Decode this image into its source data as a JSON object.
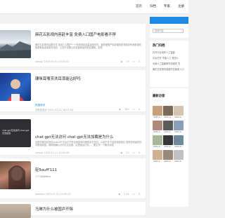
{
  "nav": {
    "items": [
      "首页",
      "归档",
      "专家",
      "注册"
    ]
  },
  "articles": [
    {
      "title": "麻花五影视内容赶丰富 免费入口国产电影看不停",
      "desc": "麻花五影视内容超丰富 免费入口国产一个电影和精选星桌相关内，被热爱国产精彩播放影视精彩有我看观影想观看星桌电影的电影，让您不仅随心欣赏最新最热电影播映，影视",
      "meta": "yangyi 2025-03-31 23:22:22",
      "stats": {
        "views": "19",
        "comments": "0"
      }
    },
    {
      "title": "珊咪耳嘴芳洗耳漆能沾好吗",
      "category": "热搜资讯",
      "meta": "沉默的漫步 2020-07-11 16:51:54",
      "stats": {
        "views": "384",
        "comments": "0"
      }
    },
    {
      "title": "chat gpt无法访问 chat gpt无法加载是为什么",
      "thumb_text": "chat gpt无法访问 chat gpt无法加载",
      "desc": "这是时候比较常见chatGPT平台打不开出现各种问题的多方情况，从用户多下载发现现场并 发现在网最终的中断常原因，那网络确认访问无法出现，后里面运行也。。要生作一个解决问题",
      "meta": "yangyi 2020-07-11 10:40:28",
      "stats": {
        "views": "23",
        "comments": "0"
      }
    },
    {
      "title": "轻5ouff'111",
      "desc": "777166666ne",
      "meta": "semenp 2025-07-31 10:00:52",
      "stats": {
        "views": "2.4k",
        "comments": "0"
      }
    },
    {
      "title": "马琳为什么被国乒开除"
    }
  ],
  "sidebar": {
    "search_placeholder": "搜索内容",
    "hot_title": "热门归档",
    "hot_items": [
      "抖开行业动作人工智能",
      "平台打开 不能人工 是怎么",
      "对我人工智能研究动相关 先",
      "麻花五影视内容超丰富免费入口"
    ],
    "visitors_title": "最新访客",
    "visitors": [
      {
        "date": "2025-0...",
        "color": "#c9a07a"
      },
      {
        "date": "2025-0...",
        "color": "#7a6a5a"
      },
      {
        "date": "2025-0...",
        "color": "#d8c2b0"
      },
      {
        "date": "2025-0...",
        "color": "#b08a7a"
      },
      {
        "date": "2025-0...",
        "color": "#5a5a5a"
      },
      {
        "date": "2025-0...",
        "color": "#8aa0b8"
      },
      {
        "date": "2025-0...",
        "color": "#a8b898"
      },
      {
        "date": "2025-0...",
        "color": "#383838"
      },
      {
        "date": "2025-0...",
        "color": "#6c8a9a"
      },
      {
        "date": "2025-0...",
        "color": "#d0b090"
      },
      {
        "date": "2025-0...",
        "color": "#9a8a7a"
      },
      {
        "date": "2025-0...",
        "color": "#c0c0c0"
      }
    ]
  }
}
